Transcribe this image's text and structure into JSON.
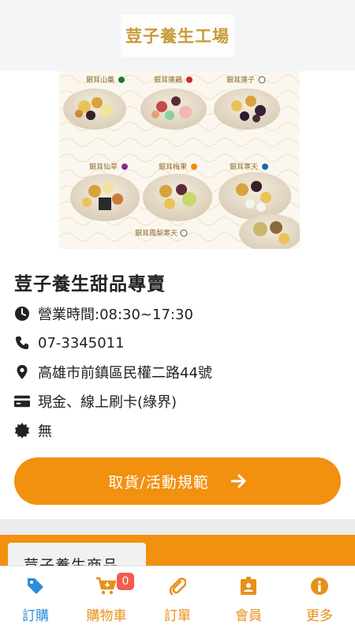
{
  "header": {
    "logo_text": "荳子養生工場"
  },
  "banner": {
    "items": [
      {
        "label": "銀耳山藥",
        "dot_color": "#1a7a3a"
      },
      {
        "label": "銀耳蓮藕",
        "dot_color": "#d02a2a"
      },
      {
        "label": "銀耳蓮子",
        "dot_color": "#ffffff"
      },
      {
        "label": "銀耳仙草",
        "dot_color": "#8a2a8a"
      },
      {
        "label": "銀耳梅果",
        "dot_color": "#f08a1a"
      },
      {
        "label": "銀耳寒天",
        "dot_color": "#1a6ab0"
      },
      {
        "label": "銀耳鳳梨寒天",
        "dot_color": "#ffffff"
      }
    ]
  },
  "store": {
    "title": "荳子養生甜品專賣",
    "hours": "營業時間:08:30~17:30",
    "phone": "07-3345011",
    "address": "高雄市前鎮區民權二路44號",
    "payment": "現金、線上刷卡(綠界)",
    "notice": "無"
  },
  "pickup_button": {
    "label": "取貨/活動規範"
  },
  "products_tab": {
    "label": "荳子養生商品"
  },
  "bottom_nav": {
    "items": [
      {
        "label": "訂購",
        "icon": "tag-icon",
        "active": true
      },
      {
        "label": "購物車",
        "icon": "cart-icon",
        "badge": "0"
      },
      {
        "label": "訂單",
        "icon": "paperclip-icon"
      },
      {
        "label": "會員",
        "icon": "id-badge-icon"
      },
      {
        "label": "更多",
        "icon": "info-icon"
      }
    ]
  },
  "colors": {
    "accent": "#f2900f",
    "active_nav": "#2a8fd6",
    "badge": "#f45b4f",
    "logo_gold": "#c99a3a"
  }
}
